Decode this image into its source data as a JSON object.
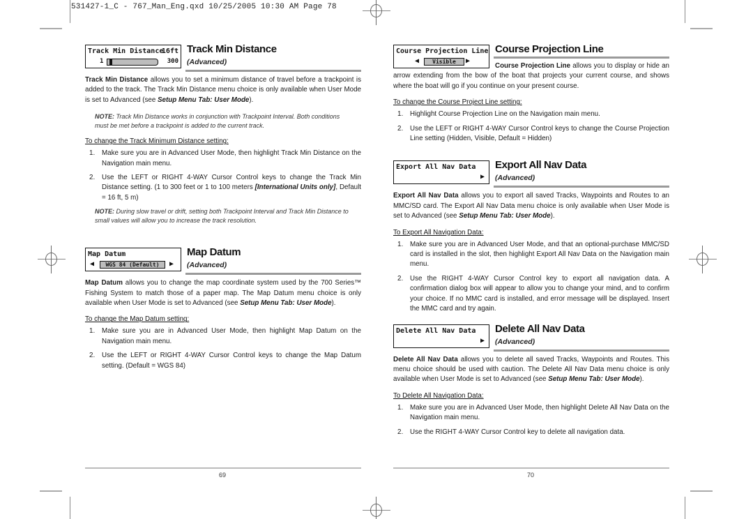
{
  "slug": "531427-1_C - 767_Man_Eng.qxd  10/25/2005  10:30 AM  Page 78",
  "left_page": {
    "page_number": "69",
    "sections": {
      "track_min": {
        "lcd": {
          "label": "Track Min Distance",
          "value": "16ft",
          "min": "1",
          "max": "300",
          "slider_position": 0.05
        },
        "title": "Track Min Distance",
        "mode": "(Advanced)",
        "body_lead": "Track Min Distance",
        "body_rest": " allows you to set a minimum distance of travel before a trackpoint is added to the track. The Track Min Distance menu choice is only available when User Mode is set to Advanced (see ",
        "body_ref": "Setup Menu Tab: User Mode",
        "body_end": ").",
        "note1_lead": "NOTE:",
        "note1": " Track Min Distance works in conjunction with Trackpoint Interval.  Both conditions must be met before a trackpoint is added to the current track.",
        "subhead": "To change the Track Minimum Distance setting:",
        "step1": "Make sure you are in Advanced User Mode, then highlight Track Min Distance on the Navigation main menu.",
        "step2_a": "Use the LEFT or RIGHT 4-WAY Cursor Control keys to change the Track Min Distance setting. (1 to 300 feet or 1 to 100 meters ",
        "step2_em": "[International Units only]",
        "step2_b": ", Default = 16 ft, 5 m)",
        "note2_lead": "NOTE:",
        "note2": " During slow travel or drift, setting both Trackpoint Interval and Track Min Distance to small values will allow you to increase the track resolution."
      },
      "map_datum": {
        "lcd": {
          "label": "Map Datum",
          "value": "WGS 84 (Default)"
        },
        "title": "Map Datum",
        "mode": "(Advanced)",
        "body_lead": "Map Datum",
        "body_rest": " allows you to change the map coordinate system used by the 700 Series™ Fishing System to match those of a paper map.  The Map Datum menu choice is only available when User Mode is set to Advanced (see ",
        "body_ref": "Setup Menu Tab: User Mode",
        "body_end": ").",
        "subhead": "To change the Map Datum setting:",
        "step1": "Make sure you are in Advanced User Mode, then highlight Map Datum on the Navigation main menu.",
        "step2": "Use the LEFT or RIGHT 4-WAY Cursor Control keys to change the Map Datum setting. (Default = WGS 84)"
      }
    }
  },
  "right_page": {
    "page_number": "70",
    "sections": {
      "course_proj": {
        "lcd": {
          "label": "Course Projection Line",
          "value": "Visible"
        },
        "title": "Course Projection Line",
        "body_lead": "Course Projection Line",
        "body_rest": " allows you to display or hide an arrow extending from the bow of the boat that projects your current course, and shows where the boat will go if you continue on your present course.",
        "subhead": "To change the Course Project Line setting:",
        "step1": "Highlight Course Projection Line on the Navigation main menu.",
        "step2": "Use the LEFT or RIGHT 4-WAY Cursor Control keys to change the Course Projection Line setting (Hidden, Visible, Default = Hidden)"
      },
      "export_nav": {
        "lcd": {
          "label": "Export All Nav Data"
        },
        "title": "Export All Nav Data",
        "mode": "(Advanced)",
        "body_lead": "Export All Nav Data",
        "body_rest": " allows you to export all saved Tracks, Waypoints and Routes to an MMC/SD card. The Export All Nav Data menu choice is only available when User Mode is set to Advanced (see ",
        "body_ref": "Setup Menu Tab: User Mode",
        "body_end": ").",
        "subhead": "To Export All Navigation Data:",
        "step1": "Make sure you are in Advanced User Mode, and that an optional-purchase MMC/SD card is installed in the slot, then highlight Export All Nav Data on the Navigation main menu.",
        "step2": "Use the RIGHT 4-WAY Cursor Control key to export all navigation data.  A confirmation dialog box will appear to allow you to change your mind, and to confirm your choice. If no MMC card is installed, and error message will be displayed. Insert the MMC card and try again."
      },
      "delete_nav": {
        "lcd": {
          "label": "Delete All Nav Data"
        },
        "title": "Delete All Nav Data",
        "mode": "(Advanced)",
        "body_lead": "Delete All Nav Data",
        "body_rest": " allows you to delete all saved Tracks, Waypoints and Routes.  This menu choice should be used with caution. The Delete All Nav Data menu choice is only available when User Mode is set to Advanced (see ",
        "body_ref": "Setup Menu Tab: User Mode",
        "body_end": ").",
        "subhead": "To Delete All Navigation Data:",
        "step1": "Make sure you are in Advanced User Mode, then highlight Delete All Nav Data on the Navigation main menu.",
        "step2": "Use the RIGHT 4-WAY Cursor Control key to delete all navigation data."
      }
    }
  },
  "step_numbers": [
    "1.",
    "2."
  ],
  "arrows": {
    "left": "◀",
    "right": "▶"
  }
}
